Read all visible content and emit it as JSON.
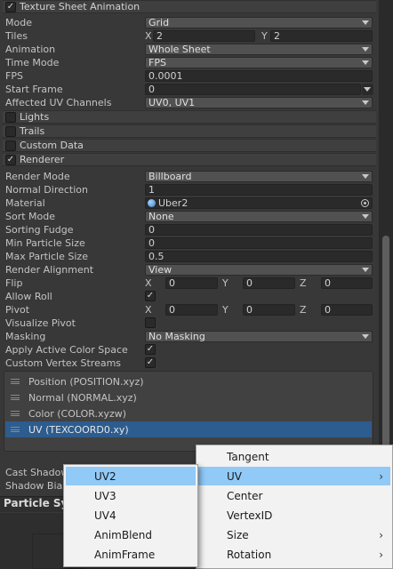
{
  "texture_sheet": {
    "title": "Texture Sheet Animation",
    "mode_label": "Mode",
    "mode_value": "Grid",
    "tiles_label": "Tiles",
    "tiles_x_axis": "X",
    "tiles_x": "2",
    "tiles_y_axis": "Y",
    "tiles_y": "2",
    "animation_label": "Animation",
    "animation_value": "Whole Sheet",
    "time_mode_label": "Time Mode",
    "time_mode_value": "FPS",
    "fps_label": "FPS",
    "fps_value": "0.0001",
    "start_frame_label": "Start Frame",
    "start_frame_value": "0",
    "uv_channels_label": "Affected UV Channels",
    "uv_channels_value": "UV0, UV1"
  },
  "sections": {
    "lights": "Lights",
    "trails": "Trails",
    "custom_data": "Custom Data",
    "renderer": "Renderer"
  },
  "renderer": {
    "render_mode_label": "Render Mode",
    "render_mode_value": "Billboard",
    "normal_direction_label": "Normal Direction",
    "normal_direction_value": "1",
    "material_label": "Material",
    "material_value": "Uber2",
    "sort_mode_label": "Sort Mode",
    "sort_mode_value": "None",
    "sorting_fudge_label": "Sorting Fudge",
    "sorting_fudge_value": "0",
    "min_particle_label": "Min Particle Size",
    "min_particle_value": "0",
    "max_particle_label": "Max Particle Size",
    "max_particle_value": "0.5",
    "render_alignment_label": "Render Alignment",
    "render_alignment_value": "View",
    "flip_label": "Flip",
    "flip_x": "0",
    "flip_y": "0",
    "flip_z": "0",
    "allow_roll_label": "Allow Roll",
    "pivot_label": "Pivot",
    "pivot_x": "0",
    "pivot_y": "0",
    "pivot_z": "0",
    "visualize_pivot_label": "Visualize Pivot",
    "masking_label": "Masking",
    "masking_value": "No Masking",
    "apply_color_space_label": "Apply Active Color Space",
    "custom_vertex_streams_label": "Custom Vertex Streams",
    "axis_x": "X",
    "axis_y": "Y",
    "axis_z": "Z",
    "check_glyph": "✓"
  },
  "streams": [
    "Position (POSITION.xyz)",
    "Normal (NORMAL.xyz)",
    "Color (COLOR.xyzw)",
    "UV (TEXCOORD0.xy)"
  ],
  "lower": {
    "cast_shadows": "Cast Shadows",
    "shadow_bias": "Shadow Bias",
    "particle_system": "Particle Sys"
  },
  "menu_main": [
    "Tangent",
    "UV",
    "Center",
    "VertexID",
    "Size",
    "Rotation"
  ],
  "menu_sub": [
    "UV2",
    "UV3",
    "UV4",
    "AnimBlend",
    "AnimFrame"
  ],
  "menu_arrow_glyph": "›",
  "colors": {
    "selection": "#2d5c8e",
    "menu_highlight": "#91c9f7",
    "panel": "#383838"
  }
}
